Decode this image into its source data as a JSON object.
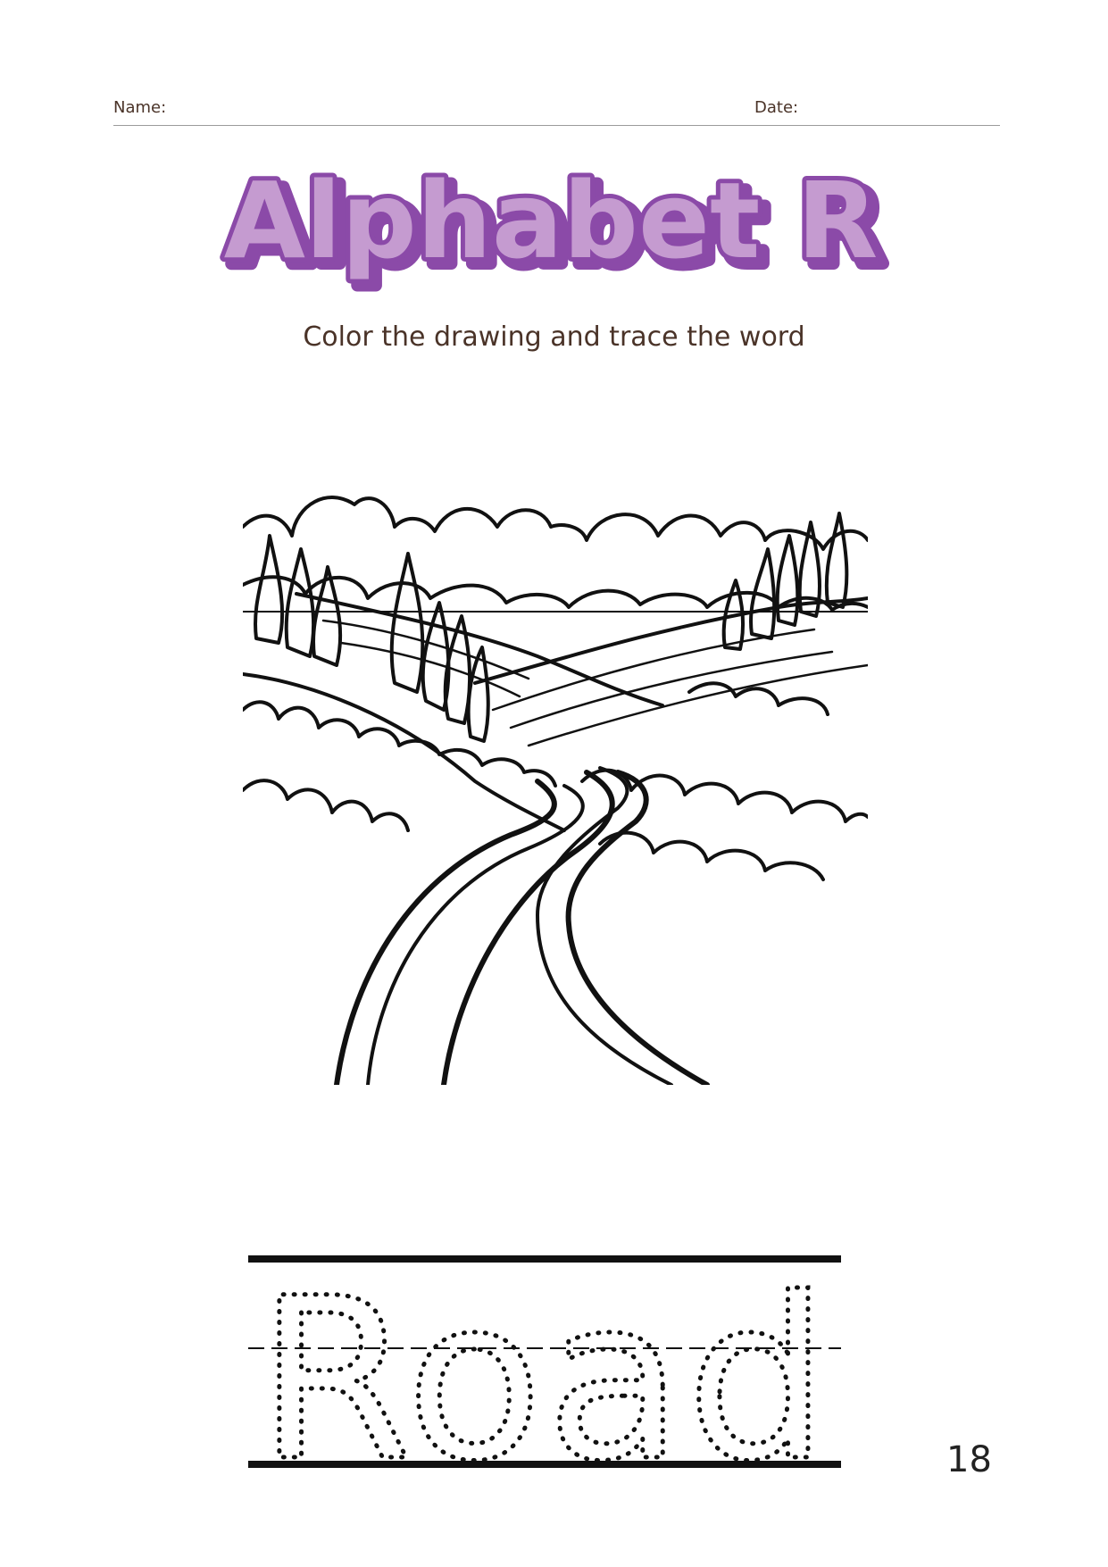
{
  "header": {
    "name_label": "Name:",
    "date_label": "Date:"
  },
  "title": "Alphabet R",
  "subtitle": "Color the drawing and trace the word",
  "trace_word": "Road",
  "page_number": "18",
  "colors": {
    "title_fill": "#c59bd0",
    "title_outline": "#8b4aa8",
    "text": "#4a3328"
  },
  "drawing": {
    "subject": "landscape with winding road, hills, trees and clouds"
  }
}
